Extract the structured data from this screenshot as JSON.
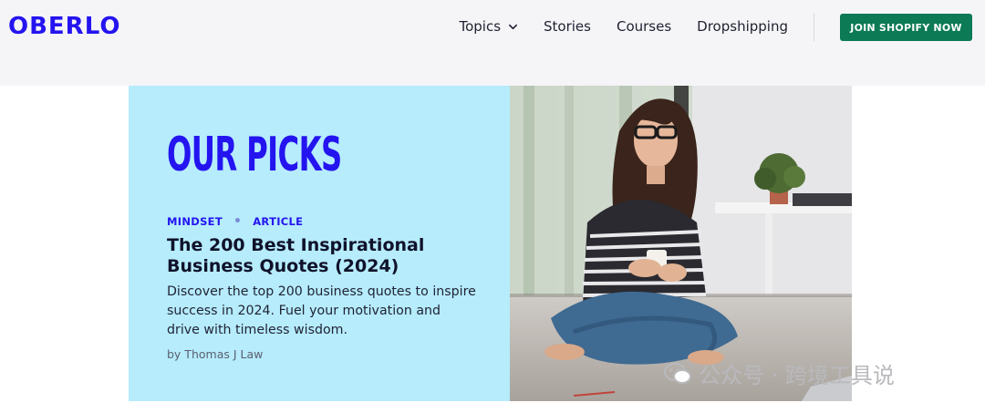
{
  "header": {
    "logo": "OBERLO",
    "nav": [
      {
        "label": "Topics",
        "has_dropdown": true
      },
      {
        "label": "Stories"
      },
      {
        "label": "Courses"
      },
      {
        "label": "Dropshipping"
      }
    ],
    "cta_label": "JOIN SHOPIFY NOW"
  },
  "hero": {
    "section_title": "OUR PICKS",
    "tags": [
      "MINDSET",
      "ARTICLE"
    ],
    "headline": "The 200 Best Inspirational Business Quotes (2024)",
    "description": "Discover the top 200 business quotes to inspire success in 2024. Fuel your motivation and drive with timeless wisdom.",
    "byline": "by Thomas J Law",
    "photo_icon": "woman-with-coffee-photo"
  },
  "watermark": {
    "text": "公众号 · 跨境工具说",
    "icon": "wechat-icon"
  },
  "colors": {
    "brand_blue": "#2414f0",
    "cta_green": "#0b7a55",
    "hero_bg": "#b6ecfc",
    "topbar_bg": "#f5f5f8"
  }
}
